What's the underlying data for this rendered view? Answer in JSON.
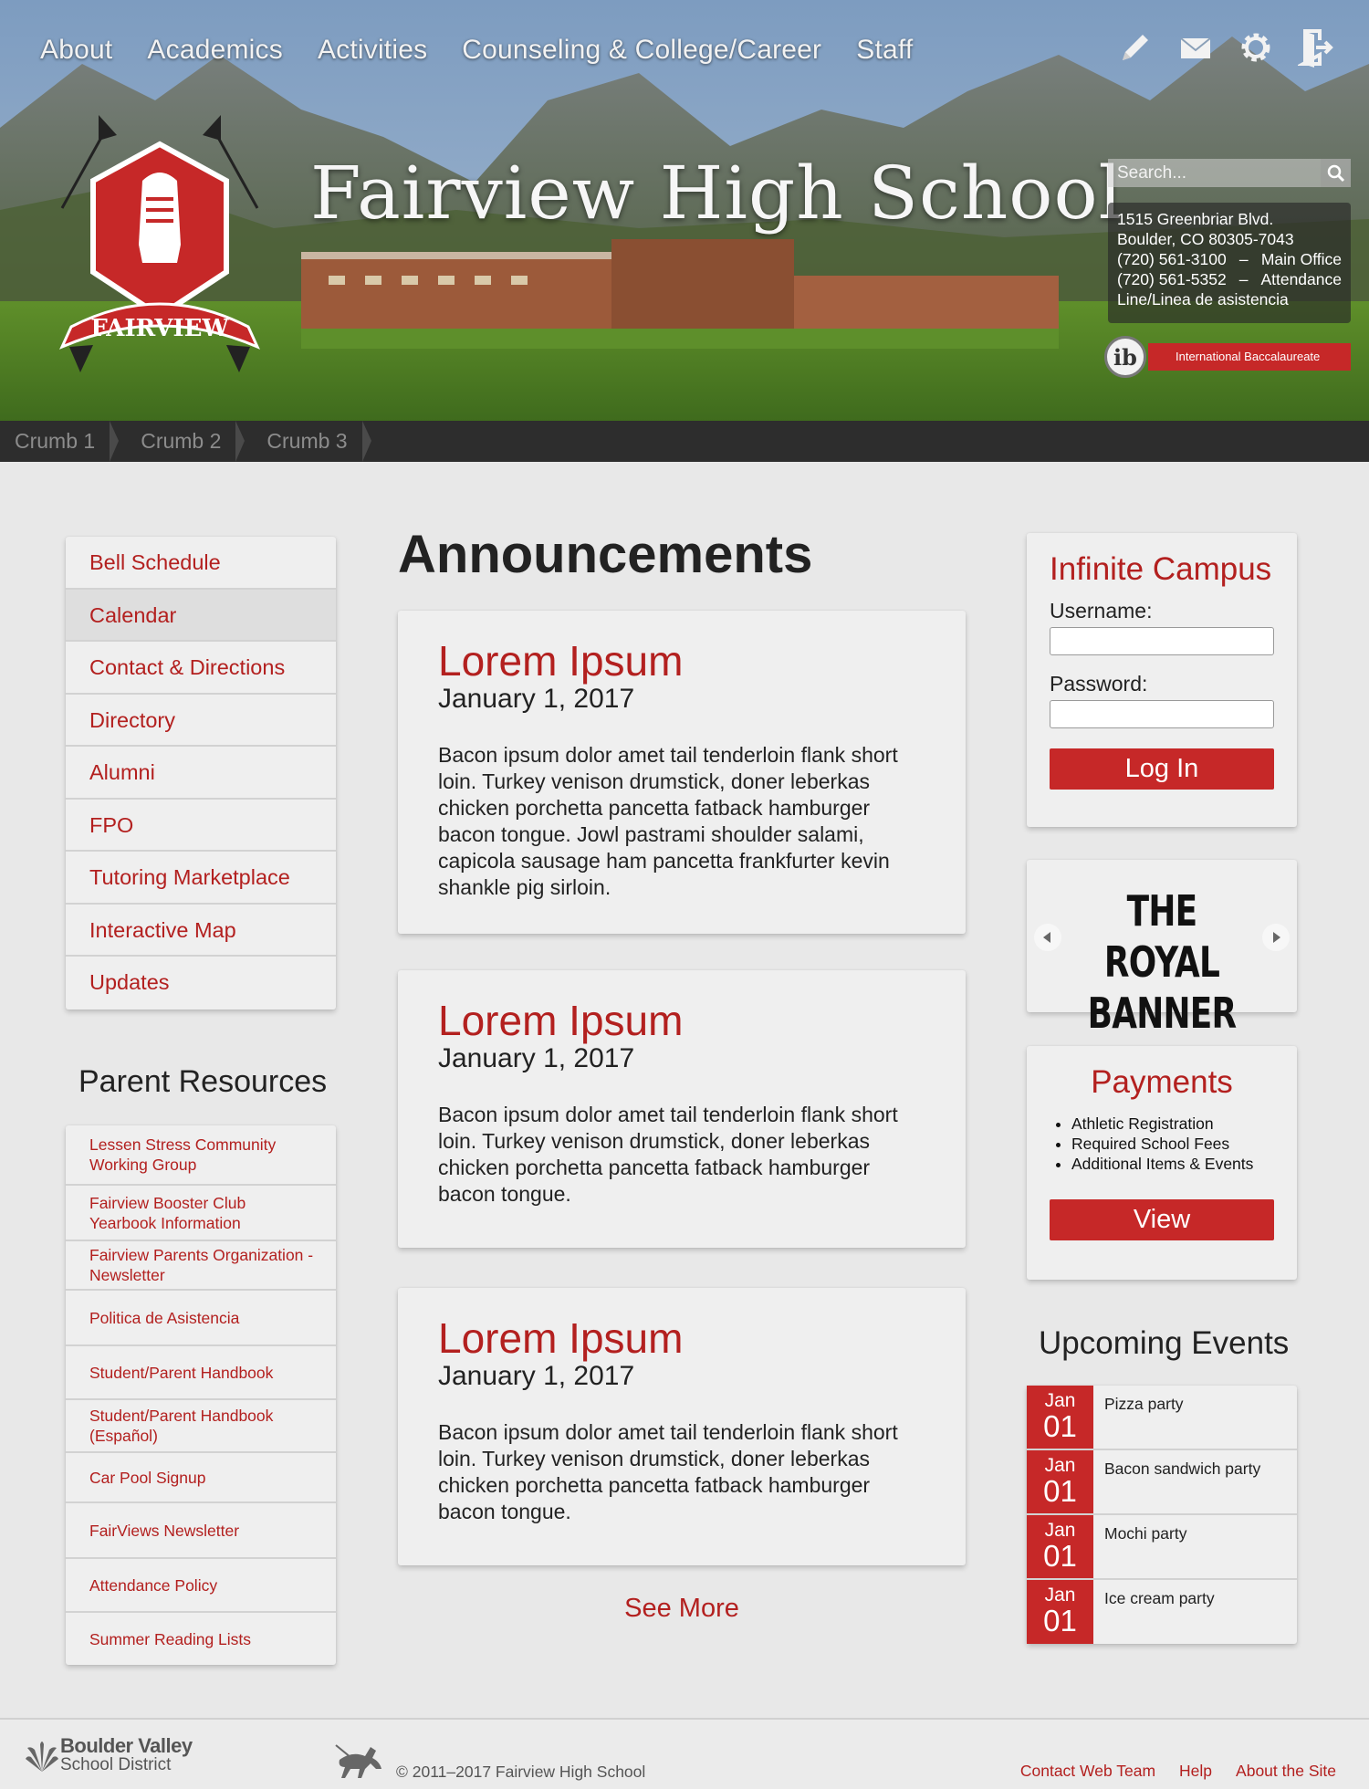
{
  "nav": {
    "items": [
      "About",
      "Academics",
      "Activities",
      "Counseling & College/Career",
      "Staff"
    ],
    "icons": [
      "pencil-icon",
      "mail-icon",
      "gear-icon",
      "sign-out-icon"
    ]
  },
  "header": {
    "school_name": "Fairview High School",
    "crest_text": "FAIRVIEW",
    "search_placeholder": "Search...",
    "address": {
      "line1": "1515 Greenbriar Blvd.",
      "line2": "Boulder, CO 80305-7043",
      "phone1": "(720) 561-3100",
      "phone1_label": "Main Office",
      "phone2": "(720) 561-5352",
      "phone2_label": "Attendance",
      "line5": "Line/Linea de asistencia"
    },
    "ib_label": "International Baccalaureate"
  },
  "breadcrumbs": [
    "Crumb 1",
    "Crumb 2",
    "Crumb 3"
  ],
  "sidebar": {
    "links": [
      "Bell Schedule",
      "Calendar",
      "Contact & Directions",
      "Directory",
      "Alumni",
      "FPO",
      "Tutoring Marketplace",
      "Interactive Map",
      "Updates"
    ],
    "active_index": 1,
    "parent_resources_title": "Parent Resources",
    "parent_resources": [
      "Lessen Stress Community Working Group",
      "Fairview Booster Club Yearbook Information",
      "Fairview Parents Organization - Newsletter",
      "Politica de Asistencia",
      "Student/Parent Handbook",
      "Student/Parent Handbook (Español)",
      "Car Pool Signup",
      "FairViews Newsletter",
      "Attendance Policy",
      "Summer Reading Lists"
    ]
  },
  "main": {
    "title": "Announcements",
    "posts": [
      {
        "heading": "Lorem Ipsum",
        "date": "January 1, 2017",
        "body": "Bacon ipsum dolor amet tail tenderloin flank short loin. Turkey venison drumstick, doner leberkas chicken porchetta pancetta fatback hamburger bacon tongue. Jowl pastrami shoulder salami, capicola sausage ham pancetta frankfurter kevin shankle pig sirloin."
      },
      {
        "heading": "Lorem Ipsum",
        "date": "January 1, 2017",
        "body": "Bacon ipsum dolor amet tail tenderloin flank short loin. Turkey venison drumstick, doner leberkas chicken porchetta pancetta fatback hamburger bacon tongue."
      },
      {
        "heading": "Lorem Ipsum",
        "date": "January 1, 2017",
        "body": "Bacon ipsum dolor amet tail tenderloin flank short loin. Turkey venison drumstick, doner leberkas chicken porchetta pancetta fatback hamburger bacon tongue."
      }
    ],
    "see_more": "See More"
  },
  "infinite_campus": {
    "title": "Infinite Campus",
    "username_label": "Username:",
    "password_label": "Password:",
    "login_label": "Log In"
  },
  "royal_banner": {
    "line1": "THE ROYAL",
    "line2": "BANNER"
  },
  "payments": {
    "title": "Payments",
    "items": [
      "Athletic Registration",
      "Required School Fees",
      "Additional Items & Events"
    ],
    "button": "View"
  },
  "events": {
    "title": "Upcoming Events",
    "items": [
      {
        "month": "Jan",
        "day": "01",
        "name": "Pizza party"
      },
      {
        "month": "Jan",
        "day": "01",
        "name": "Bacon sandwich party"
      },
      {
        "month": "Jan",
        "day": "01",
        "name": "Mochi party"
      },
      {
        "month": "Jan",
        "day": "01",
        "name": "Ice cream party"
      }
    ]
  },
  "footer": {
    "district_line1": "Boulder Valley",
    "district_line2": "School District",
    "copyright": "© 2011–2017 Fairview High School",
    "links": [
      "Contact Web Team",
      "Help",
      "About the Site"
    ]
  },
  "colors": {
    "accent": "#c62828",
    "link": "#b3201f",
    "crumb_bar": "#2d2d2d",
    "background": "#e8e8e8"
  }
}
